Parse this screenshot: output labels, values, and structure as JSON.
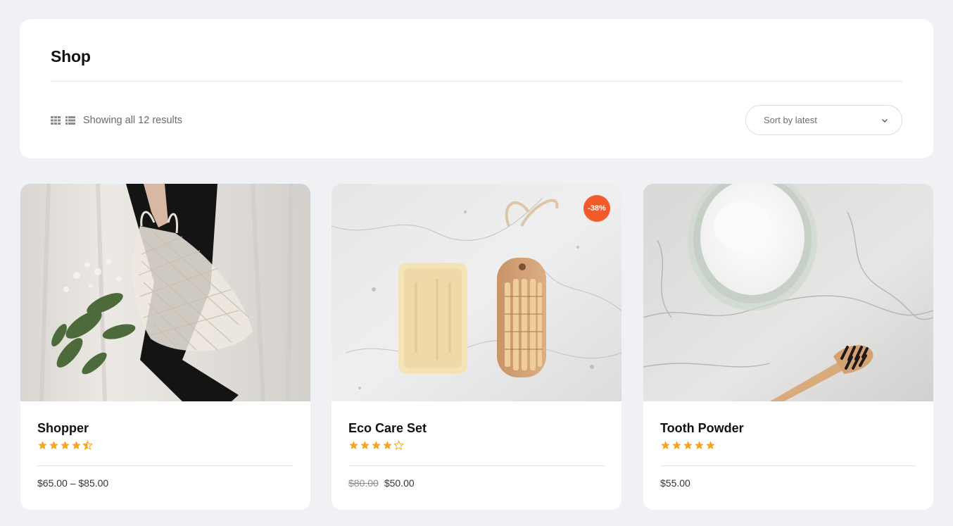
{
  "page": {
    "title": "Shop"
  },
  "toolbar": {
    "grid_icon": "grid-view-icon",
    "list_icon": "list-view-icon",
    "result_count": "Showing all 12 results",
    "sort": {
      "selected": "Sort by latest",
      "icon": "chevron-down-icon"
    }
  },
  "colors": {
    "star": "#f5a623",
    "badge": "#f25a2a",
    "background": "#f0f1f5"
  },
  "products": [
    {
      "name": "Shopper",
      "rating": 4.5,
      "price": "$65.00 – $85.00",
      "image": "mesh-bag-with-greenery"
    },
    {
      "name": "Eco Care Set",
      "rating": 4,
      "old_price": "$80.00",
      "price": "$50.00",
      "badge": "-38%",
      "image": "soap-and-brush-on-marble"
    },
    {
      "name": "Tooth Powder",
      "rating": 5,
      "price": "$55.00",
      "image": "tooth-powder-jar-and-bamboo-toothbrush"
    }
  ]
}
